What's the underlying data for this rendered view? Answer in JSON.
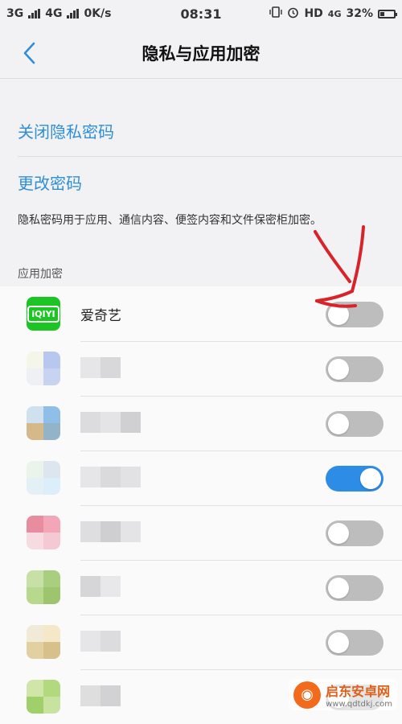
{
  "status_bar": {
    "network1": "3G",
    "network2": "4G",
    "speed": "0K/s",
    "time": "08:31",
    "hd": "HD",
    "network3": "4G",
    "battery": "32%",
    "battery_level": 0.32
  },
  "header": {
    "title": "隐私与应用加密"
  },
  "menu": {
    "items": [
      {
        "label": "关闭隐私密码"
      },
      {
        "label": "更改密码"
      }
    ]
  },
  "description": "隐私密码用于应用、通信内容、便签内容和文件保密柜加密。",
  "section_label": "应用加密",
  "apps": [
    {
      "name": "爱奇艺",
      "icon": "iqiyi-icon",
      "icon_text": "iQIYI",
      "encrypted": false
    },
    {
      "name": "",
      "icon": "blurred-app-icon",
      "encrypted": false
    },
    {
      "name": "",
      "icon": "blurred-app-icon",
      "encrypted": false
    },
    {
      "name": "",
      "icon": "blurred-app-icon",
      "encrypted": true
    },
    {
      "name": "",
      "icon": "blurred-app-icon",
      "encrypted": false
    },
    {
      "name": "",
      "icon": "blurred-app-icon",
      "encrypted": false
    },
    {
      "name": "",
      "icon": "blurred-app-icon",
      "encrypted": false
    },
    {
      "name": "",
      "icon": "blurred-app-icon",
      "encrypted": false
    }
  ],
  "colors": {
    "accent": "#2f8fd8",
    "toggle_on": "#2c8ce6",
    "toggle_off": "#bdbdbd",
    "annotation": "#d9232a"
  },
  "watermark": {
    "title": "启东安卓网",
    "url": "www.qdtdkj.com"
  }
}
